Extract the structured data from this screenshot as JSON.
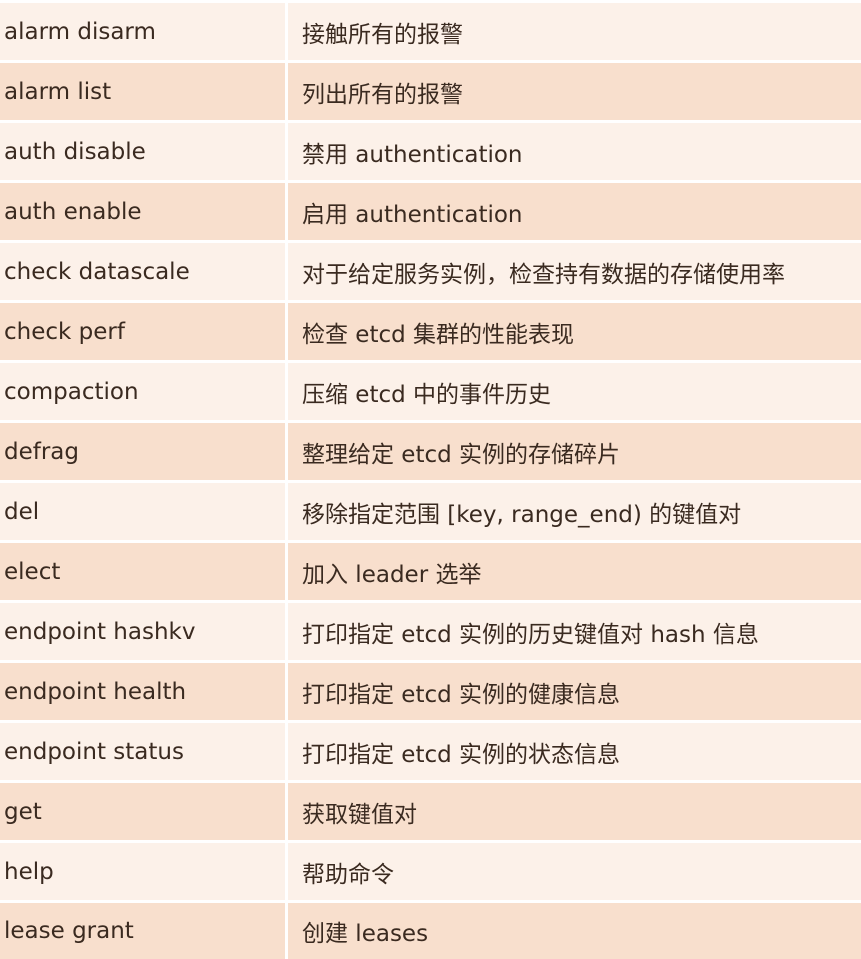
{
  "table": {
    "rows": [
      {
        "command": "alarm disarm",
        "description": "接触所有的报警"
      },
      {
        "command": "alarm list",
        "description": "列出所有的报警"
      },
      {
        "command": "auth disable",
        "description": "禁用 authentication"
      },
      {
        "command": "auth enable",
        "description": "启用 authentication"
      },
      {
        "command": "check datascale",
        "description": "对于给定服务实例，检查持有数据的存储使用率"
      },
      {
        "command": "check perf",
        "description": "检查 etcd 集群的性能表现"
      },
      {
        "command": "compaction",
        "description": "压缩 etcd 中的事件历史"
      },
      {
        "command": "defrag",
        "description": "整理给定 etcd 实例的存储碎片"
      },
      {
        "command": "del",
        "description": "移除指定范围 [key, range_end) 的键值对"
      },
      {
        "command": "elect",
        "description": "加入 leader 选举"
      },
      {
        "command": "endpoint hashkv",
        "description": "打印指定 etcd 实例的历史键值对 hash 信息"
      },
      {
        "command": "endpoint health",
        "description": "打印指定 etcd 实例的健康信息"
      },
      {
        "command": "endpoint status",
        "description": "打印指定 etcd 实例的状态信息"
      },
      {
        "command": "get",
        "description": "获取键值对"
      },
      {
        "command": "help",
        "description": "帮助命令"
      },
      {
        "command": "lease grant",
        "description": "创建 leases"
      }
    ]
  }
}
